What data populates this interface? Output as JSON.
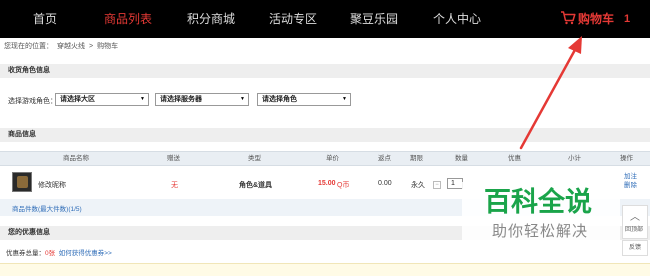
{
  "nav": {
    "items": [
      {
        "label": "首页"
      },
      {
        "label": "商品列表"
      },
      {
        "label": "积分商城"
      },
      {
        "label": "活动专区"
      },
      {
        "label": "聚豆乐园"
      },
      {
        "label": "个人中心"
      }
    ],
    "active": "商品列表",
    "cart_label": "购物车",
    "cart_count": "1"
  },
  "breadcrumb": {
    "prefix": "您现在的位置：",
    "items": [
      "穿越火线",
      ">",
      "购物车"
    ]
  },
  "role_section": {
    "title": "收货角色信息",
    "label": "选择游戏角色：",
    "selects": [
      "请选择大区",
      "请选择服务器",
      "请选择角色"
    ]
  },
  "goods_section": {
    "title": "商品信息",
    "columns": [
      "商品名称",
      "赠送",
      "类型",
      "单价",
      "返点",
      "期限",
      "数量",
      "优惠",
      "小计",
      "操作"
    ],
    "row": {
      "name": "修改昵称",
      "gift": "无",
      "type": "角色&道具",
      "price": "15.00",
      "price_unit": "Q币",
      "rebate": "0.00",
      "term": "永久",
      "quantity": "1",
      "op1": "加注",
      "op2": "删除"
    },
    "expand_link": "商品件数(最大件数)(1/5)"
  },
  "coupon_section": {
    "title": "您的优惠信息",
    "label": "优惠券总量：",
    "count": "0张",
    "link": "如何获得优惠券>>"
  },
  "side": {
    "back_top": "回顶部",
    "feedback": "反馈"
  },
  "watermark": {
    "title": "百科全说",
    "subtitle": "助你轻松解决"
  },
  "colors": {
    "nav_bg": "#000000",
    "accent_red": "#e53935",
    "link_blue": "#2f6db8",
    "watermark_green": "#1aa44a"
  }
}
